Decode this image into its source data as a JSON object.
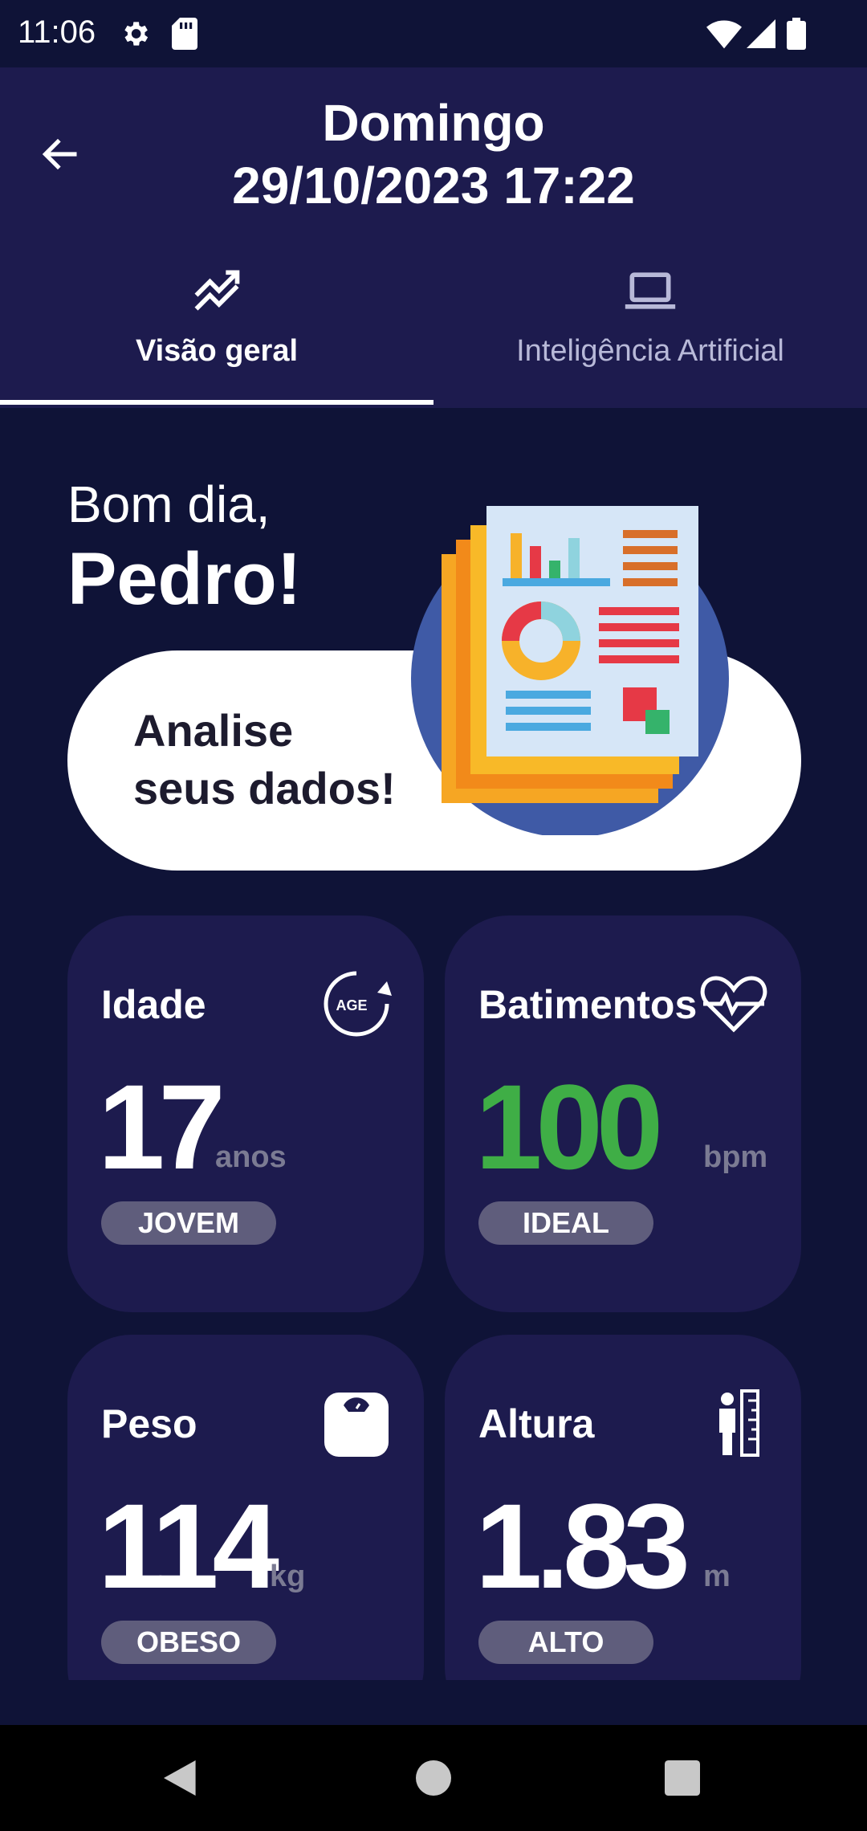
{
  "status_bar": {
    "time": "11:06",
    "icons": [
      "gear-icon",
      "sd-card-icon",
      "wifi-icon",
      "signal-icon",
      "battery-icon"
    ]
  },
  "header": {
    "day": "Domingo",
    "datetime": "29/10/2023 17:22",
    "back_icon": "arrow-left-icon"
  },
  "tabs": [
    {
      "label": "Visão geral",
      "icon": "trend-chart-icon",
      "selected": true
    },
    {
      "label": "Inteligência Artificial",
      "icon": "laptop-icon",
      "selected": false
    }
  ],
  "greeting": {
    "line1": "Bom dia,",
    "line2": "Pedro!"
  },
  "banner": {
    "line1": "Analise",
    "line2": "seus dados!",
    "illustration": "report-documents-illustration"
  },
  "cards": [
    {
      "title": "Idade",
      "value": "17",
      "unit": "anos",
      "badge": "JOVEM",
      "icon": "age-icon"
    },
    {
      "title": "Batimentos",
      "value": "100",
      "unit": "bpm",
      "badge": "IDEAL",
      "icon": "heartbeat-icon",
      "value_color": "#3fae46"
    },
    {
      "title": "Peso",
      "value": "114",
      "unit": "kg",
      "badge": "OBESO",
      "icon": "scale-icon"
    },
    {
      "title": "Altura",
      "value": "1.83",
      "unit": "m",
      "badge": "ALTO",
      "icon": "height-icon"
    }
  ],
  "icons": {
    "age_label": "AGE"
  },
  "colors": {
    "background": "#0f1337",
    "appbar": "#1d1b4e",
    "card": "#1d1b4e",
    "accent_green": "#3fae46",
    "badge": "#5f5d7c"
  },
  "nav": [
    "back-triangle-icon",
    "home-circle-icon",
    "recents-square-icon"
  ]
}
